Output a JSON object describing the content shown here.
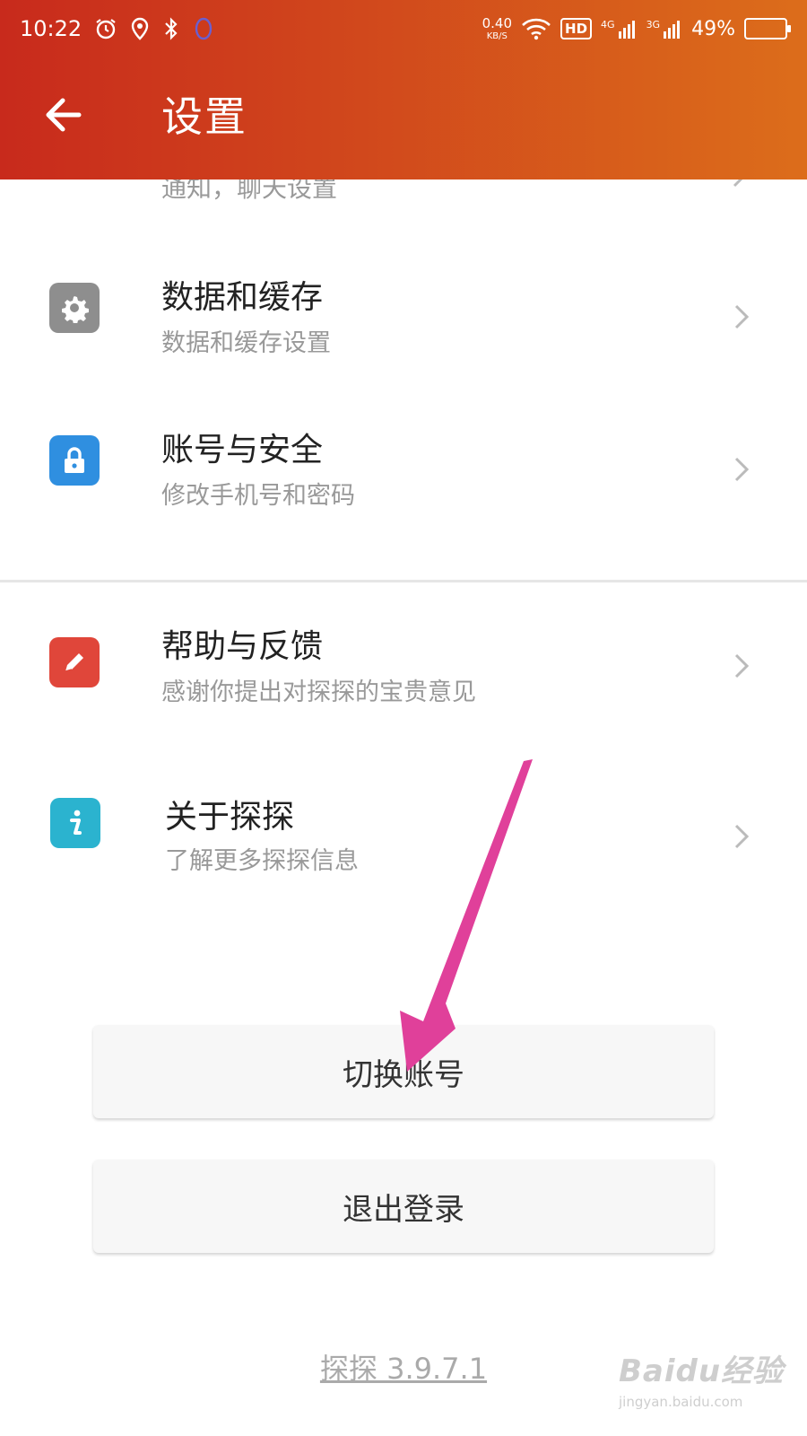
{
  "status_bar": {
    "time": "10:22",
    "net_speed_value": "0.40",
    "net_speed_unit": "KB/S",
    "hd": "HD",
    "net1": "4G",
    "net2": "3G",
    "battery_pct": "49%",
    "battery_level": 0.49
  },
  "header": {
    "title": "设置"
  },
  "partial_item": {
    "subtitle": "通知，聊天设置"
  },
  "items": [
    {
      "title": "数据和缓存",
      "subtitle": "数据和缓存设置",
      "icon": "gear-icon",
      "color": "#8e8e8e"
    },
    {
      "title": "账号与安全",
      "subtitle": "修改手机号和密码",
      "icon": "lock-icon",
      "color": "#2f8fe0"
    },
    {
      "title": "帮助与反馈",
      "subtitle": "感谢你提出对探探的宝贵意见",
      "icon": "pencil-icon",
      "color": "#e0463a"
    },
    {
      "title": "关于探探",
      "subtitle": "了解更多探探信息",
      "icon": "info-icon",
      "color": "#2bb3cf"
    }
  ],
  "buttons": {
    "switch_account": "切换账号",
    "logout": "退出登录"
  },
  "version": "探探 3.9.7.1",
  "watermark": {
    "brand": "Baidu经验",
    "url": "jingyan.baidu.com"
  },
  "colors": {
    "header_start": "#c82a1c",
    "header_end": "#dc6d1b",
    "annotation_arrow": "#e0409a"
  }
}
